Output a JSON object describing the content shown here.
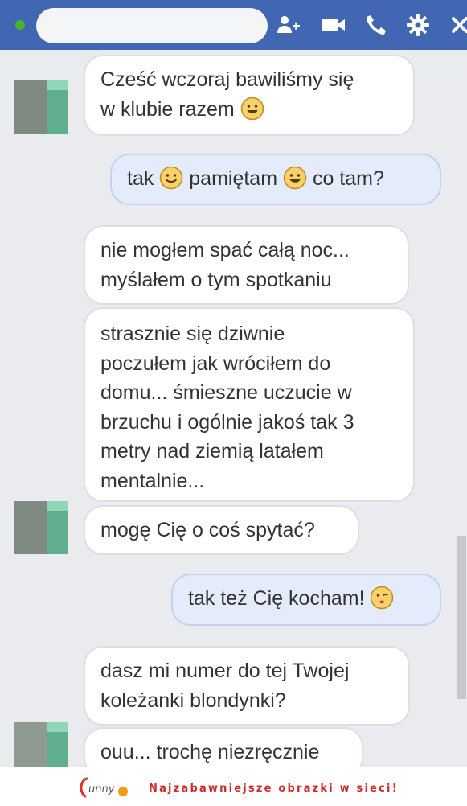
{
  "icons": [
    "add-friend-icon",
    "video-call-icon",
    "phone-icon",
    "gear-icon",
    "close-icon"
  ],
  "messages": [
    {
      "lines": [
        "Cześć wczoraj bawiliśmy się",
        "w klubie razem"
      ]
    },
    {
      "parts": [
        "tak",
        "pamiętam",
        "co tam?"
      ]
    },
    {
      "lines": [
        "nie mogłem spać całą noc...",
        "myślałem o tym spotkaniu"
      ]
    },
    {
      "lines": [
        "strasznie się dziwnie",
        "poczułem jak wróciłem do",
        "domu... śmieszne uczucie w",
        "brzuchu i ogólnie jakoś tak 3",
        "metry nad ziemią latałem",
        "mentalnie..."
      ]
    },
    {
      "lines": [
        "mogę Cię o coś spytać?"
      ]
    },
    {
      "lines": [
        "tak też Cię kocham!"
      ]
    },
    {
      "lines": [
        "dasz mi numer do tej Twojej",
        "koleżanki blondynki?"
      ]
    },
    {
      "lines": [
        "ouu... trochę niezręcznie"
      ]
    }
  ],
  "footer": {
    "logo": "funny",
    "tagline": "Najzabawniejsze obrazki w sieci!"
  },
  "colors": {
    "header": "#4267b2",
    "online": "#42b72a",
    "incoming": "#ffffff",
    "outgoing": "#e4ecfb",
    "tagline": "#cf2b2b"
  }
}
